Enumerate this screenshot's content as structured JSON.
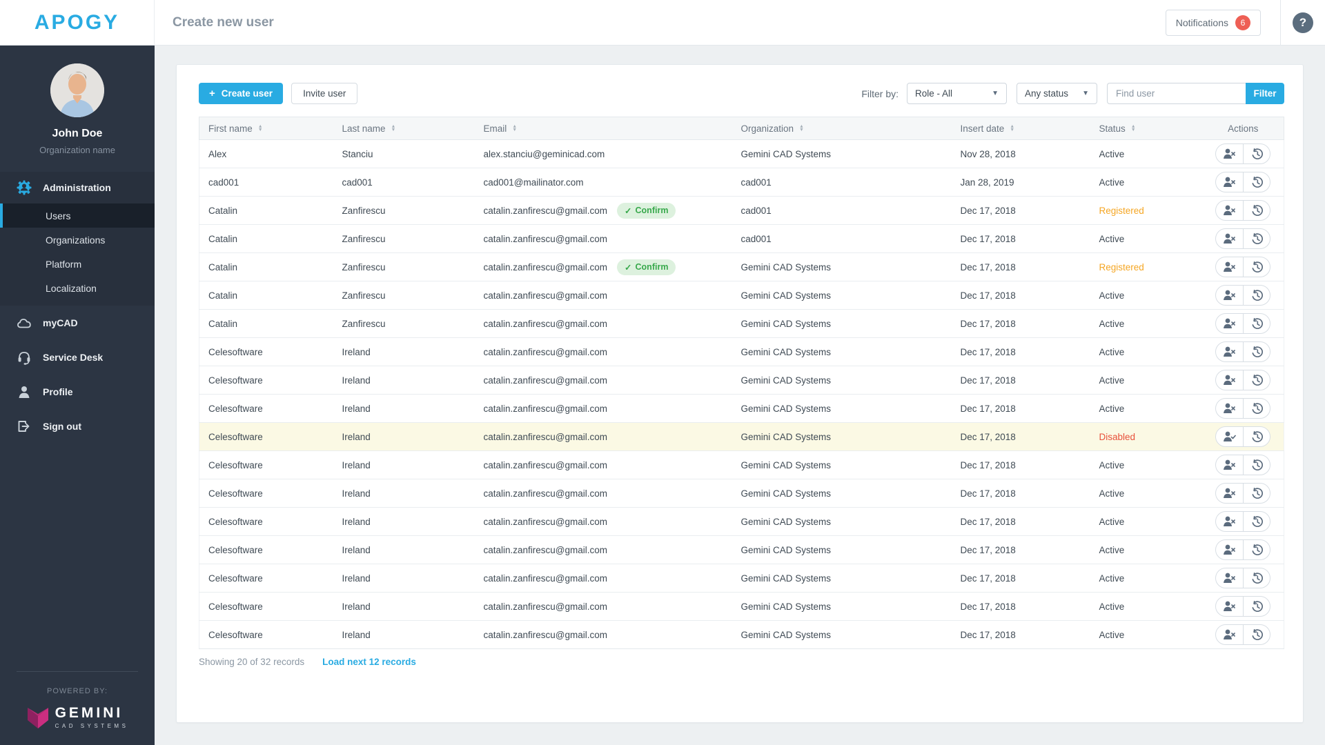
{
  "brand": {
    "logo_text": "APOGY",
    "accent_color": "#29abe2"
  },
  "header": {
    "title": "Create new user",
    "notifications_label": "Notifications",
    "notifications_count": "6",
    "help_glyph": "?"
  },
  "sidebar": {
    "user": {
      "name": "John Doe",
      "org": "Organization name"
    },
    "menu": {
      "administration": "Administration",
      "users": "Users",
      "organizations": "Organizations",
      "platform": "Platform",
      "localization": "Localization",
      "mycad": "myCAD",
      "service_desk": "Service Desk",
      "profile": "Profile",
      "sign_out": "Sign out"
    },
    "powered_by": "POWERED BY:",
    "partner_logo_title": "GEMINI",
    "partner_logo_subtitle": "CAD SYSTEMS"
  },
  "toolbar": {
    "create_user": "Create user",
    "invite_user": "Invite user",
    "filter_by": "Filter by:",
    "role_filter_value": "Role - All",
    "status_filter_value": "Any status",
    "find_user_placeholder": "Find user",
    "filter_button": "Filter"
  },
  "table": {
    "columns": [
      "First name",
      "Last name",
      "Email",
      "Organization",
      "Insert date",
      "Status",
      "Actions"
    ],
    "confirm_label": "Confirm",
    "rows": [
      {
        "first": "Alex",
        "last": "Stanciu",
        "email": "alex.stanciu@geminicad.com",
        "confirm": false,
        "org": "Gemini CAD Systems",
        "date": "Nov 28, 2018",
        "status": "Active"
      },
      {
        "first": "cad001",
        "last": "cad001",
        "email": "cad001@mailinator.com",
        "confirm": false,
        "org": "cad001",
        "date": "Jan 28, 2019",
        "status": "Active"
      },
      {
        "first": "Catalin",
        "last": "Zanfirescu",
        "email": "catalin.zanfirescu@gmail.com",
        "confirm": true,
        "org": "cad001",
        "date": "Dec 17, 2018",
        "status": "Registered"
      },
      {
        "first": "Catalin",
        "last": "Zanfirescu",
        "email": "catalin.zanfirescu@gmail.com",
        "confirm": false,
        "org": "cad001",
        "date": "Dec 17, 2018",
        "status": "Active"
      },
      {
        "first": "Catalin",
        "last": "Zanfirescu",
        "email": "catalin.zanfirescu@gmail.com",
        "confirm": true,
        "org": "Gemini CAD Systems",
        "date": "Dec 17, 2018",
        "status": "Registered"
      },
      {
        "first": "Catalin",
        "last": "Zanfirescu",
        "email": "catalin.zanfirescu@gmail.com",
        "confirm": false,
        "org": "Gemini CAD Systems",
        "date": "Dec 17, 2018",
        "status": "Active"
      },
      {
        "first": "Catalin",
        "last": "Zanfirescu",
        "email": "catalin.zanfirescu@gmail.com",
        "confirm": false,
        "org": "Gemini CAD Systems",
        "date": "Dec 17, 2018",
        "status": "Active"
      },
      {
        "first": "Celesoftware",
        "last": "Ireland",
        "email": "catalin.zanfirescu@gmail.com",
        "confirm": false,
        "org": "Gemini CAD Systems",
        "date": "Dec 17, 2018",
        "status": "Active"
      },
      {
        "first": "Celesoftware",
        "last": "Ireland",
        "email": "catalin.zanfirescu@gmail.com",
        "confirm": false,
        "org": "Gemini CAD Systems",
        "date": "Dec 17, 2018",
        "status": "Active"
      },
      {
        "first": "Celesoftware",
        "last": "Ireland",
        "email": "catalin.zanfirescu@gmail.com",
        "confirm": false,
        "org": "Gemini CAD Systems",
        "date": "Dec 17, 2018",
        "status": "Active"
      },
      {
        "first": "Celesoftware",
        "last": "Ireland",
        "email": "catalin.zanfirescu@gmail.com",
        "confirm": false,
        "org": "Gemini CAD Systems",
        "date": "Dec 17, 2018",
        "status": "Disabled"
      },
      {
        "first": "Celesoftware",
        "last": "Ireland",
        "email": "catalin.zanfirescu@gmail.com",
        "confirm": false,
        "org": "Gemini CAD Systems",
        "date": "Dec 17, 2018",
        "status": "Active"
      },
      {
        "first": "Celesoftware",
        "last": "Ireland",
        "email": "catalin.zanfirescu@gmail.com",
        "confirm": false,
        "org": "Gemini CAD Systems",
        "date": "Dec 17, 2018",
        "status": "Active"
      },
      {
        "first": "Celesoftware",
        "last": "Ireland",
        "email": "catalin.zanfirescu@gmail.com",
        "confirm": false,
        "org": "Gemini CAD Systems",
        "date": "Dec 17, 2018",
        "status": "Active"
      },
      {
        "first": "Celesoftware",
        "last": "Ireland",
        "email": "catalin.zanfirescu@gmail.com",
        "confirm": false,
        "org": "Gemini CAD Systems",
        "date": "Dec 17, 2018",
        "status": "Active"
      },
      {
        "first": "Celesoftware",
        "last": "Ireland",
        "email": "catalin.zanfirescu@gmail.com",
        "confirm": false,
        "org": "Gemini CAD Systems",
        "date": "Dec 17, 2018",
        "status": "Active"
      },
      {
        "first": "Celesoftware",
        "last": "Ireland",
        "email": "catalin.zanfirescu@gmail.com",
        "confirm": false,
        "org": "Gemini CAD Systems",
        "date": "Dec 17, 2018",
        "status": "Active"
      },
      {
        "first": "Celesoftware",
        "last": "Ireland",
        "email": "catalin.zanfirescu@gmail.com",
        "confirm": false,
        "org": "Gemini CAD Systems",
        "date": "Dec 17, 2018",
        "status": "Active"
      }
    ]
  },
  "footer": {
    "showing": "Showing 20 of 32 records",
    "load_more": "Load next 12 records"
  },
  "colors": {
    "accent": "#29abe2",
    "sidebar_bg": "#2c3543",
    "status_registered": "#f5a623",
    "status_disabled": "#e8503a",
    "disabled_row_bg": "#fbf9e4",
    "confirm_badge_bg": "#ddf1de",
    "confirm_badge_text": "#38a94c",
    "notification_badge": "#ee5f55"
  }
}
